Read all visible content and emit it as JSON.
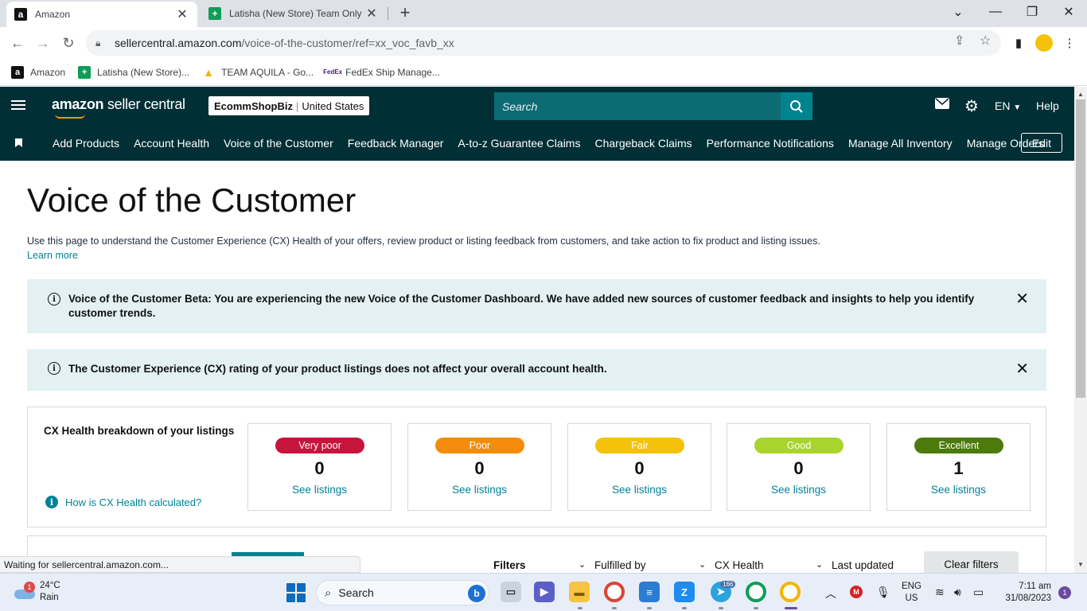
{
  "browser": {
    "tabs": [
      {
        "title": "Amazon",
        "favicon": "a"
      },
      {
        "title": "Latisha (New Store) Team Only - ",
        "favicon": "+"
      }
    ],
    "url_host": "sellercentral.amazon.com",
    "url_path": "/voice-of-the-customer/ref=xx_voc_favb_xx",
    "bookmarks": [
      {
        "label": "Amazon",
        "icon": "a"
      },
      {
        "label": "Latisha (New Store)...",
        "icon": "+"
      },
      {
        "label": "TEAM AQUILA - Go...",
        "icon": "▲"
      },
      {
        "label": "FedEx Ship Manage...",
        "icon": "FedEx"
      }
    ],
    "status": "Waiting for sellercentral.amazon.com..."
  },
  "header": {
    "logo_bold": "amazon",
    "logo_light": " seller central",
    "store_name": "EcommShopBiz",
    "store_region": "United States",
    "search_placeholder": "Search",
    "language": "EN",
    "help": "Help"
  },
  "nav": {
    "items": [
      "Add Products",
      "Account Health",
      "Voice of the Customer",
      "Feedback Manager",
      "A-to-z Guarantee Claims",
      "Chargeback Claims",
      "Performance Notifications",
      "Manage All Inventory",
      "Manage Orders"
    ],
    "edit": "Edit"
  },
  "main": {
    "title": "Voice of the Customer",
    "description": "Use this page to understand the Customer Experience (CX) Health of your offers, review product or listing feedback from customers, and take action to fix product and listing issues.",
    "learn_more": "Learn more",
    "alert_beta": "Voice of the Customer Beta: You are experiencing the new Voice of the Customer Dashboard. We have added new sources of customer feedback and insights to help you identify customer trends.",
    "alert_rating": "The Customer Experience (CX) rating of your product listings does not affect your overall account health.",
    "cx_title": "CX Health breakdown of your listings",
    "cx_how": "How is CX Health calculated?",
    "cx_cards": [
      {
        "label": "Very poor",
        "count": "0",
        "link": "See listings",
        "color": "#c7143d"
      },
      {
        "label": "Poor",
        "count": "0",
        "link": "See listings",
        "color": "#f48b0a"
      },
      {
        "label": "Fair",
        "count": "0",
        "link": "See listings",
        "color": "#f4c20b"
      },
      {
        "label": "Good",
        "count": "0",
        "link": "See listings",
        "color": "#a8d42c"
      },
      {
        "label": "Excellent",
        "count": "1",
        "link": "See listings",
        "color": "#4c7a0b"
      }
    ],
    "filters": {
      "label": "Filters",
      "fulfilled_by": "Fulfilled by",
      "cx_health": "CX Health",
      "last_updated": "Last updated",
      "clear": "Clear filters"
    }
  },
  "taskbar": {
    "weather_temp": "24°C",
    "weather_desc": "Rain",
    "weather_badge": "1",
    "search": "Search",
    "telegram_badge": "166",
    "lang_top": "ENG",
    "lang_bottom": "US",
    "time": "7:11 am",
    "date": "31/08/2023",
    "notif_count": "1"
  },
  "colors": {
    "header_bg": "#002f36",
    "search_bg": "#0d6b74",
    "link": "#008296",
    "alert_bg": "#e3f1f3"
  }
}
